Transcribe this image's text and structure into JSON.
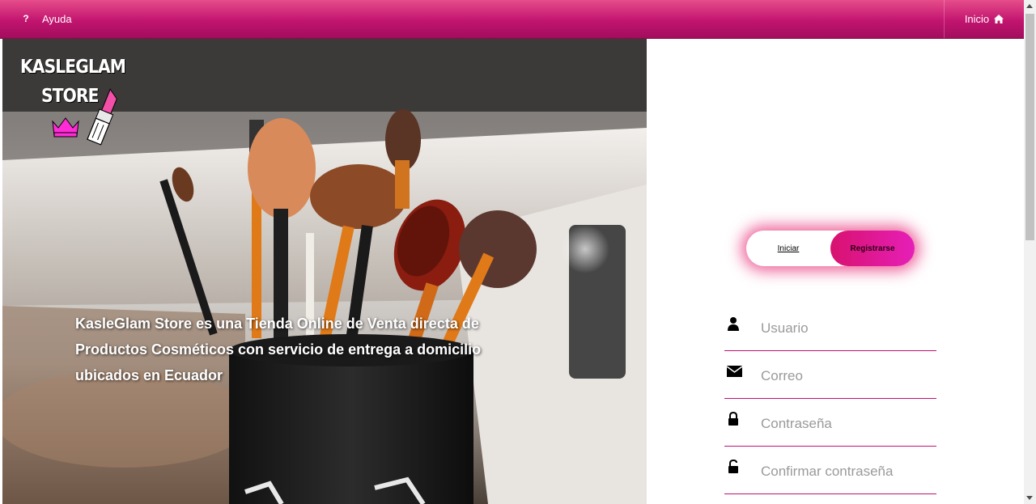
{
  "navbar": {
    "help_icon": "?",
    "help_label": "Ayuda",
    "home_label": "Inicio",
    "home_icon": "home-icon",
    "gradient_top": "#e64d8a",
    "gradient_bottom": "#a20d5c"
  },
  "hero": {
    "logo_line1": "KASLEGLAM",
    "logo_line2": "STORE",
    "description": "KasleGlam Store es una Tienda Online de Venta directa de Productos Cosméticos con servicio de entrega a domicilio ubicados en Ecuador"
  },
  "auth": {
    "tab_login": "Iniciar",
    "tab_register": "Registrarse",
    "accent": "#e61f8c",
    "fields": [
      {
        "placeholder": "Usuario",
        "icon": "user-icon"
      },
      {
        "placeholder": "Correo",
        "icon": "envelope-icon"
      },
      {
        "placeholder": "Contraseña",
        "icon": "lock-icon"
      },
      {
        "placeholder": "Confirmar contraseña",
        "icon": "unlock-icon"
      }
    ]
  }
}
